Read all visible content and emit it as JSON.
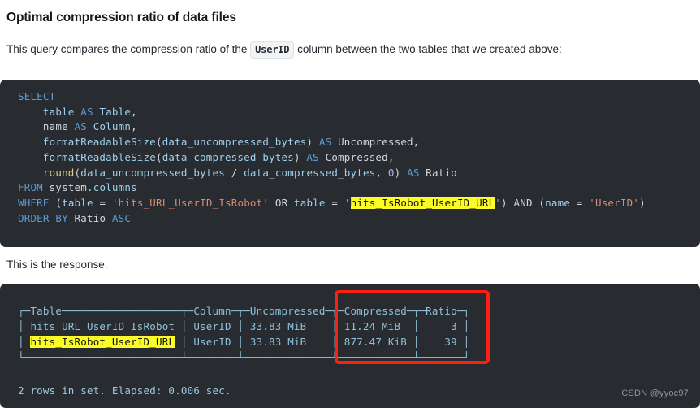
{
  "page": {
    "heading": "Optimal compression ratio of data files",
    "intro_before": "This query compares the compression ratio of the",
    "intro_code": "UserID",
    "intro_after": "column between the two tables that we created above:",
    "response_label": "This is the response:",
    "watermark": "CSDN @yyoc97"
  },
  "code_block": {
    "language": "sql",
    "background_color": "#282c30",
    "highlight_color": "#fbfb26",
    "keyword_color": "#5b9bd5",
    "identifier_color": "#9fd0f0",
    "string_color": "#d98c72",
    "function_color": "#e0cd8a",
    "highlighted_text": "hits_IsRobot_UserID_URL",
    "lines": [
      "SELECT",
      "    table AS Table,",
      "    name AS Column,",
      "    formatReadableSize(data_uncompressed_bytes) AS Uncompressed,",
      "    formatReadableSize(data_compressed_bytes) AS Compressed,",
      "    round(data_uncompressed_bytes / data_compressed_bytes, 0) AS Ratio",
      "FROM system.columns",
      "WHERE (table = 'hits_URL_UserID_IsRobot' OR table = 'hits_IsRobot_UserID_URL') AND (name = 'UserID')",
      "ORDER BY Ratio ASC"
    ]
  },
  "response_block": {
    "background_color": "#282c30",
    "border_art_color": "#8fc0dc",
    "highlighted_row_value": "hits_IsRobot_UserID_URL",
    "annotation_box_color": "#fc1f13",
    "annotated_columns": [
      "Compressed",
      "Ratio"
    ],
    "columns": [
      "Table",
      "Column",
      "Uncompressed",
      "Compressed",
      "Ratio"
    ],
    "rows": [
      {
        "Table": "hits_URL_UserID_IsRobot",
        "Column": "UserID",
        "Uncompressed": "33.83 MiB",
        "Compressed": "11.24 MiB",
        "Ratio": "3",
        "highlighted": false
      },
      {
        "Table": "hits_IsRobot_UserID_URL",
        "Column": "UserID",
        "Uncompressed": "33.83 MiB",
        "Compressed": "877.47 KiB",
        "Ratio": "39",
        "highlighted": true
      }
    ],
    "art_header": "┌─Table───────────────────┬─Column─┬─Uncompressed─┬─Compressed─┬─Ratio─┐",
    "art_row1": "│ hits_URL_UserID_IsRobot │ UserID │ 33.83 MiB    │ 11.24 MiB  │     3 │",
    "art_row2a": "│ ",
    "art_row2b": " │ UserID │ 33.83 MiB    │ 877.47 KiB │    39 │",
    "art_footer": "└─────────────────────────┴────────┴──────────────┴────────────┴───────┘",
    "footer_text": "2 rows in set. Elapsed: 0.006 sec."
  }
}
